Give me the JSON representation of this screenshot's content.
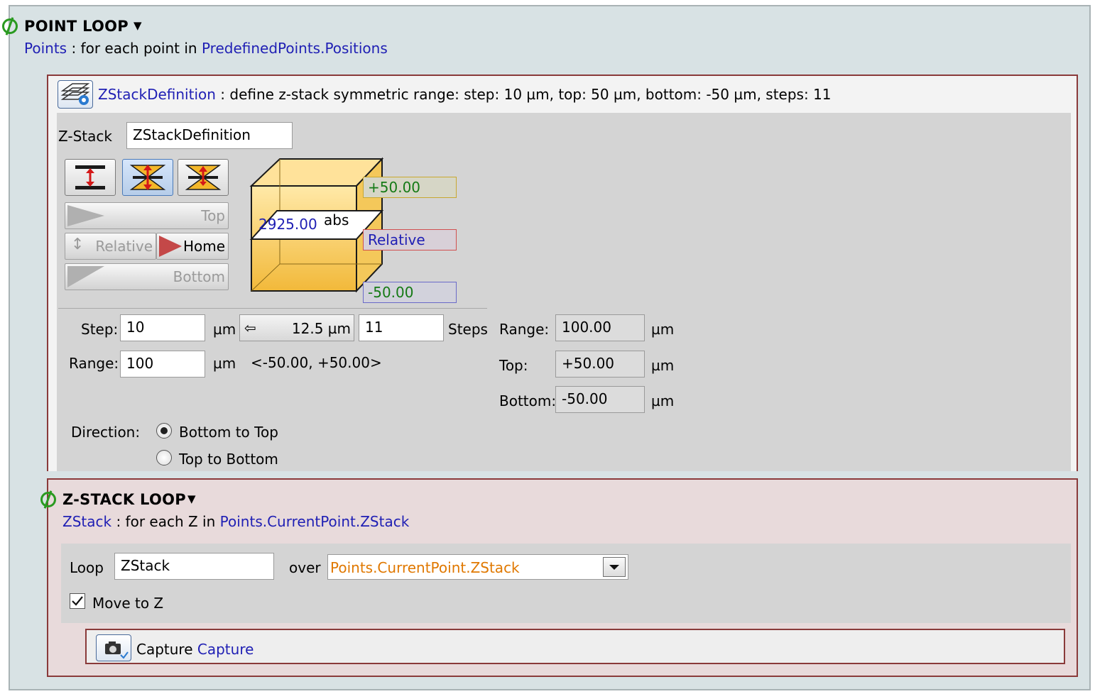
{
  "point_loop": {
    "title": "POINT LOOP",
    "caret": "▼",
    "var_name": "Points",
    "sep": ":",
    "desc_pre": "for each point in",
    "source": "PredefinedPoints.Positions"
  },
  "zstack_def": {
    "name": "ZStackDefinition",
    "description": ": define z-stack symmetric range: step: 10 µm, top: 50 µm, bottom: -50 µm, steps: 11",
    "zstack_label": "Z-Stack",
    "zstack_value": "ZStackDefinition",
    "buttons": {
      "top": "Top",
      "relative": "Relative",
      "home": "Home",
      "bottom": "Bottom"
    },
    "cube": {
      "top_value": "+50.00",
      "current_value": "2925.00",
      "abs_label": "abs",
      "relative_label": "Relative",
      "bottom_value": "-50.00"
    },
    "step_label": "Step:",
    "step_value": "10",
    "step_unit": "µm",
    "step_calc": "12.5 µm",
    "steps_value": "11",
    "steps_label": "Steps",
    "range_label": "Range:",
    "range_value": "100",
    "range_unit": "µm",
    "range_text": "<-50.00, +50.00>",
    "out_range_label": "Range:",
    "out_range_value": "100.00",
    "out_top_label": "Top:",
    "out_top_value": "+50.00",
    "out_bottom_label": "Bottom:",
    "out_bottom_value": "-50.00",
    "unit": "µm",
    "direction_label": "Direction:",
    "direction_options": [
      "Bottom to Top",
      "Top to Bottom"
    ],
    "direction_selected": "Bottom to Top"
  },
  "zstack_loop": {
    "title": "Z-STACK LOOP",
    "caret": "▼",
    "var_name": "ZStack",
    "sep": ":",
    "desc_pre": "for each Z in",
    "source": "Points.CurrentPoint.ZStack",
    "loop_label": "Loop",
    "loop_value": "ZStack",
    "over_label": "over",
    "over_value": "Points.CurrentPoint.ZStack",
    "move_label": "Move to Z",
    "move_checked": true
  },
  "capture": {
    "label": "Capture",
    "name": "Capture"
  },
  "colors": {
    "link_blue": "#1f1fb4",
    "value_green": "#157a15",
    "accent_orange": "#e07800",
    "border_maroon": "#8a3a3a"
  }
}
